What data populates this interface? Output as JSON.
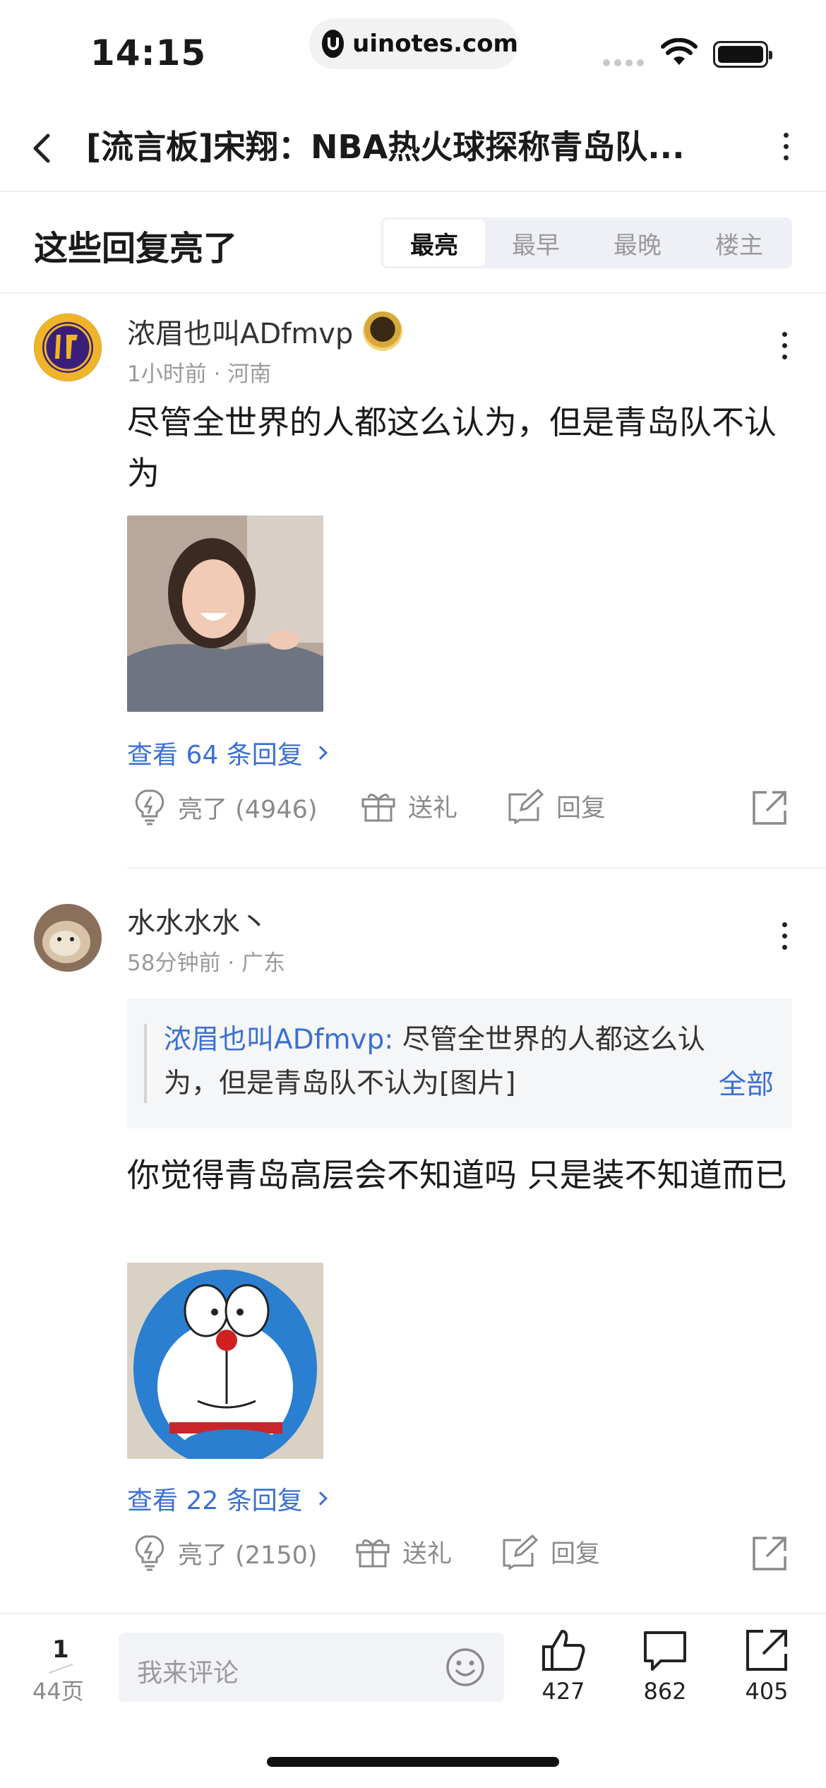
{
  "status": {
    "time": "14:15",
    "url": "uinotes.com"
  },
  "nav": {
    "title": "[流言板]宋翔：NBA热火球探称青岛队..."
  },
  "filter": {
    "title": "这些回复亮了",
    "tabs": [
      "最亮",
      "最早",
      "最晚",
      "楼主"
    ],
    "active_tab": "最亮"
  },
  "posts": [
    {
      "username": "浓眉也叫ADfmvp",
      "meta": "1小时前 · 河南",
      "content": "尽管全世界的人都这么认为，但是青岛队不认为",
      "view_replies": "查看 64 条回复",
      "like_label": "亮了 (4946)",
      "gift_label": "送礼",
      "reply_label": "回复"
    },
    {
      "username": "水水水水丶",
      "meta": "58分钟前 · 广东",
      "quote_user": "浓眉也叫ADfmvp:",
      "quote_text": " 尽管全世界的人都这么认为，但是青岛队不认为[图片]",
      "quote_all": "全部",
      "content": "你觉得青岛高层会不知道吗 只是装不知道而已",
      "view_replies": "查看 22 条回复",
      "like_label": "亮了 (2150)",
      "gift_label": "送礼",
      "reply_label": "回复"
    }
  ],
  "bottom": {
    "page_current": "1",
    "page_total": "44页",
    "comment_placeholder": "我来评论",
    "likes": "427",
    "comments": "862",
    "shares": "405"
  },
  "icons": {
    "back": "back-arrow-icon",
    "more": "more-vertical-icon",
    "like": "lightbulb-icon",
    "gift": "gift-icon",
    "reply": "edit-reply-icon",
    "share": "share-icon",
    "thumb_up": "thumbs-up-icon",
    "comment": "comment-bubble-icon",
    "emoji": "smiley-icon"
  },
  "colors": {
    "link": "#3b6fd4",
    "muted": "#9a9a9a"
  }
}
